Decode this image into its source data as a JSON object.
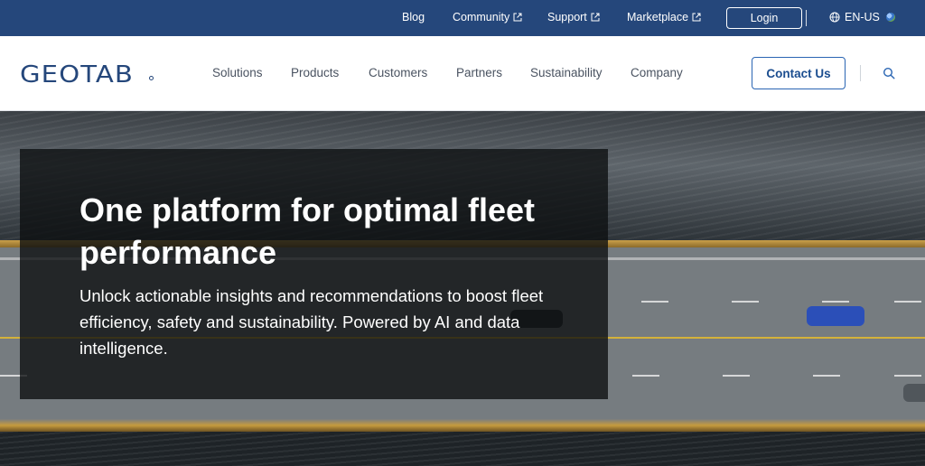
{
  "topbar": {
    "links": [
      {
        "label": "Blog",
        "external": false
      },
      {
        "label": "Community",
        "external": true
      },
      {
        "label": "Support",
        "external": true
      },
      {
        "label": "Marketplace",
        "external": true
      }
    ],
    "login_label": "Login",
    "language": "EN-US"
  },
  "nav": {
    "logo": "GEOTAB",
    "items": [
      "Solutions",
      "Products",
      "Customers",
      "Partners",
      "Sustainability",
      "Company"
    ],
    "contact_label": "Contact Us"
  },
  "hero": {
    "title": "One platform for optimal fleet performance",
    "subtitle": "Unlock actionable insights and recommendations to boost fleet efficiency, safety and sustainability. Powered by AI and data intelligence."
  },
  "colors": {
    "topbar_bg": "#25477b",
    "brand": "#25477b",
    "cta_border": "#2a65b3"
  }
}
